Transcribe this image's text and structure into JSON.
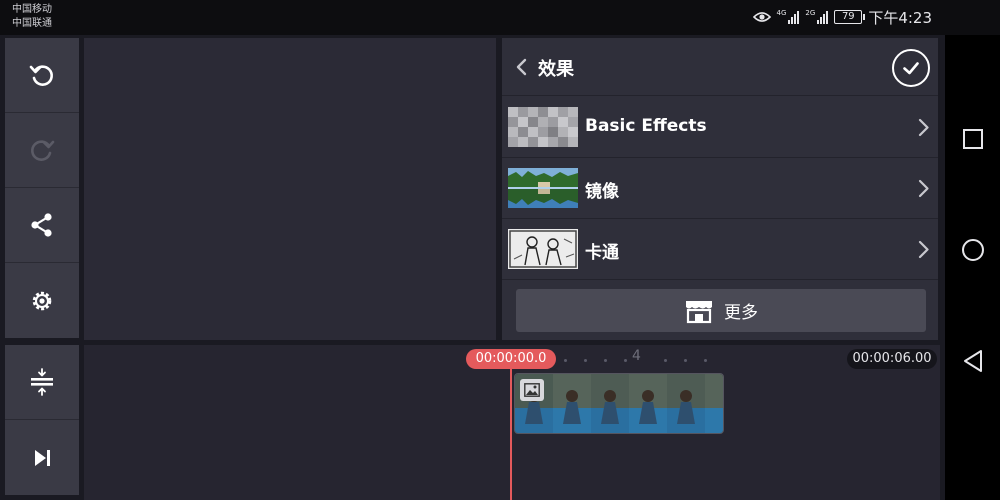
{
  "status_bar": {
    "carrier_1": "中国移动",
    "carrier_2": "中国联通",
    "signal_1_label": "4G",
    "signal_2_label": "2G",
    "battery": "79",
    "time": "下午4:23",
    "icons": [
      "eye-icon",
      "signal-icon",
      "signal-icon",
      "battery-icon"
    ]
  },
  "toolbar": {
    "top_buttons": [
      {
        "name": "undo-button",
        "icon": "undo-icon"
      },
      {
        "name": "redo-button",
        "icon": "redo-icon",
        "enabled": false
      },
      {
        "name": "share-button",
        "icon": "share-icon"
      },
      {
        "name": "settings-button",
        "icon": "gear-icon"
      }
    ],
    "bottom_buttons": [
      {
        "name": "track-adjust-button",
        "icon": "track-adjust-icon"
      },
      {
        "name": "skip-to-end-button",
        "icon": "skip-end-icon"
      }
    ]
  },
  "effects_panel": {
    "title": "效果",
    "items": [
      {
        "label": "Basic Effects",
        "thumb": "mosaic"
      },
      {
        "label": "镜像",
        "thumb": "mirror-landscape"
      },
      {
        "label": "卡通",
        "thumb": "cartoon"
      }
    ],
    "more_label": "更多"
  },
  "timeline": {
    "current_time": "00:00:00.0",
    "end_time": "00:00:06.00",
    "ruler_mark": "4",
    "clip_frame_count": 5
  },
  "colors": {
    "accent_red": "#e45a5c",
    "panel_bg": "#2f2f3a",
    "toolbar_btn": "#3a3a45",
    "preview_bg": "#2b2a36",
    "timeline_bg": "#262530"
  }
}
